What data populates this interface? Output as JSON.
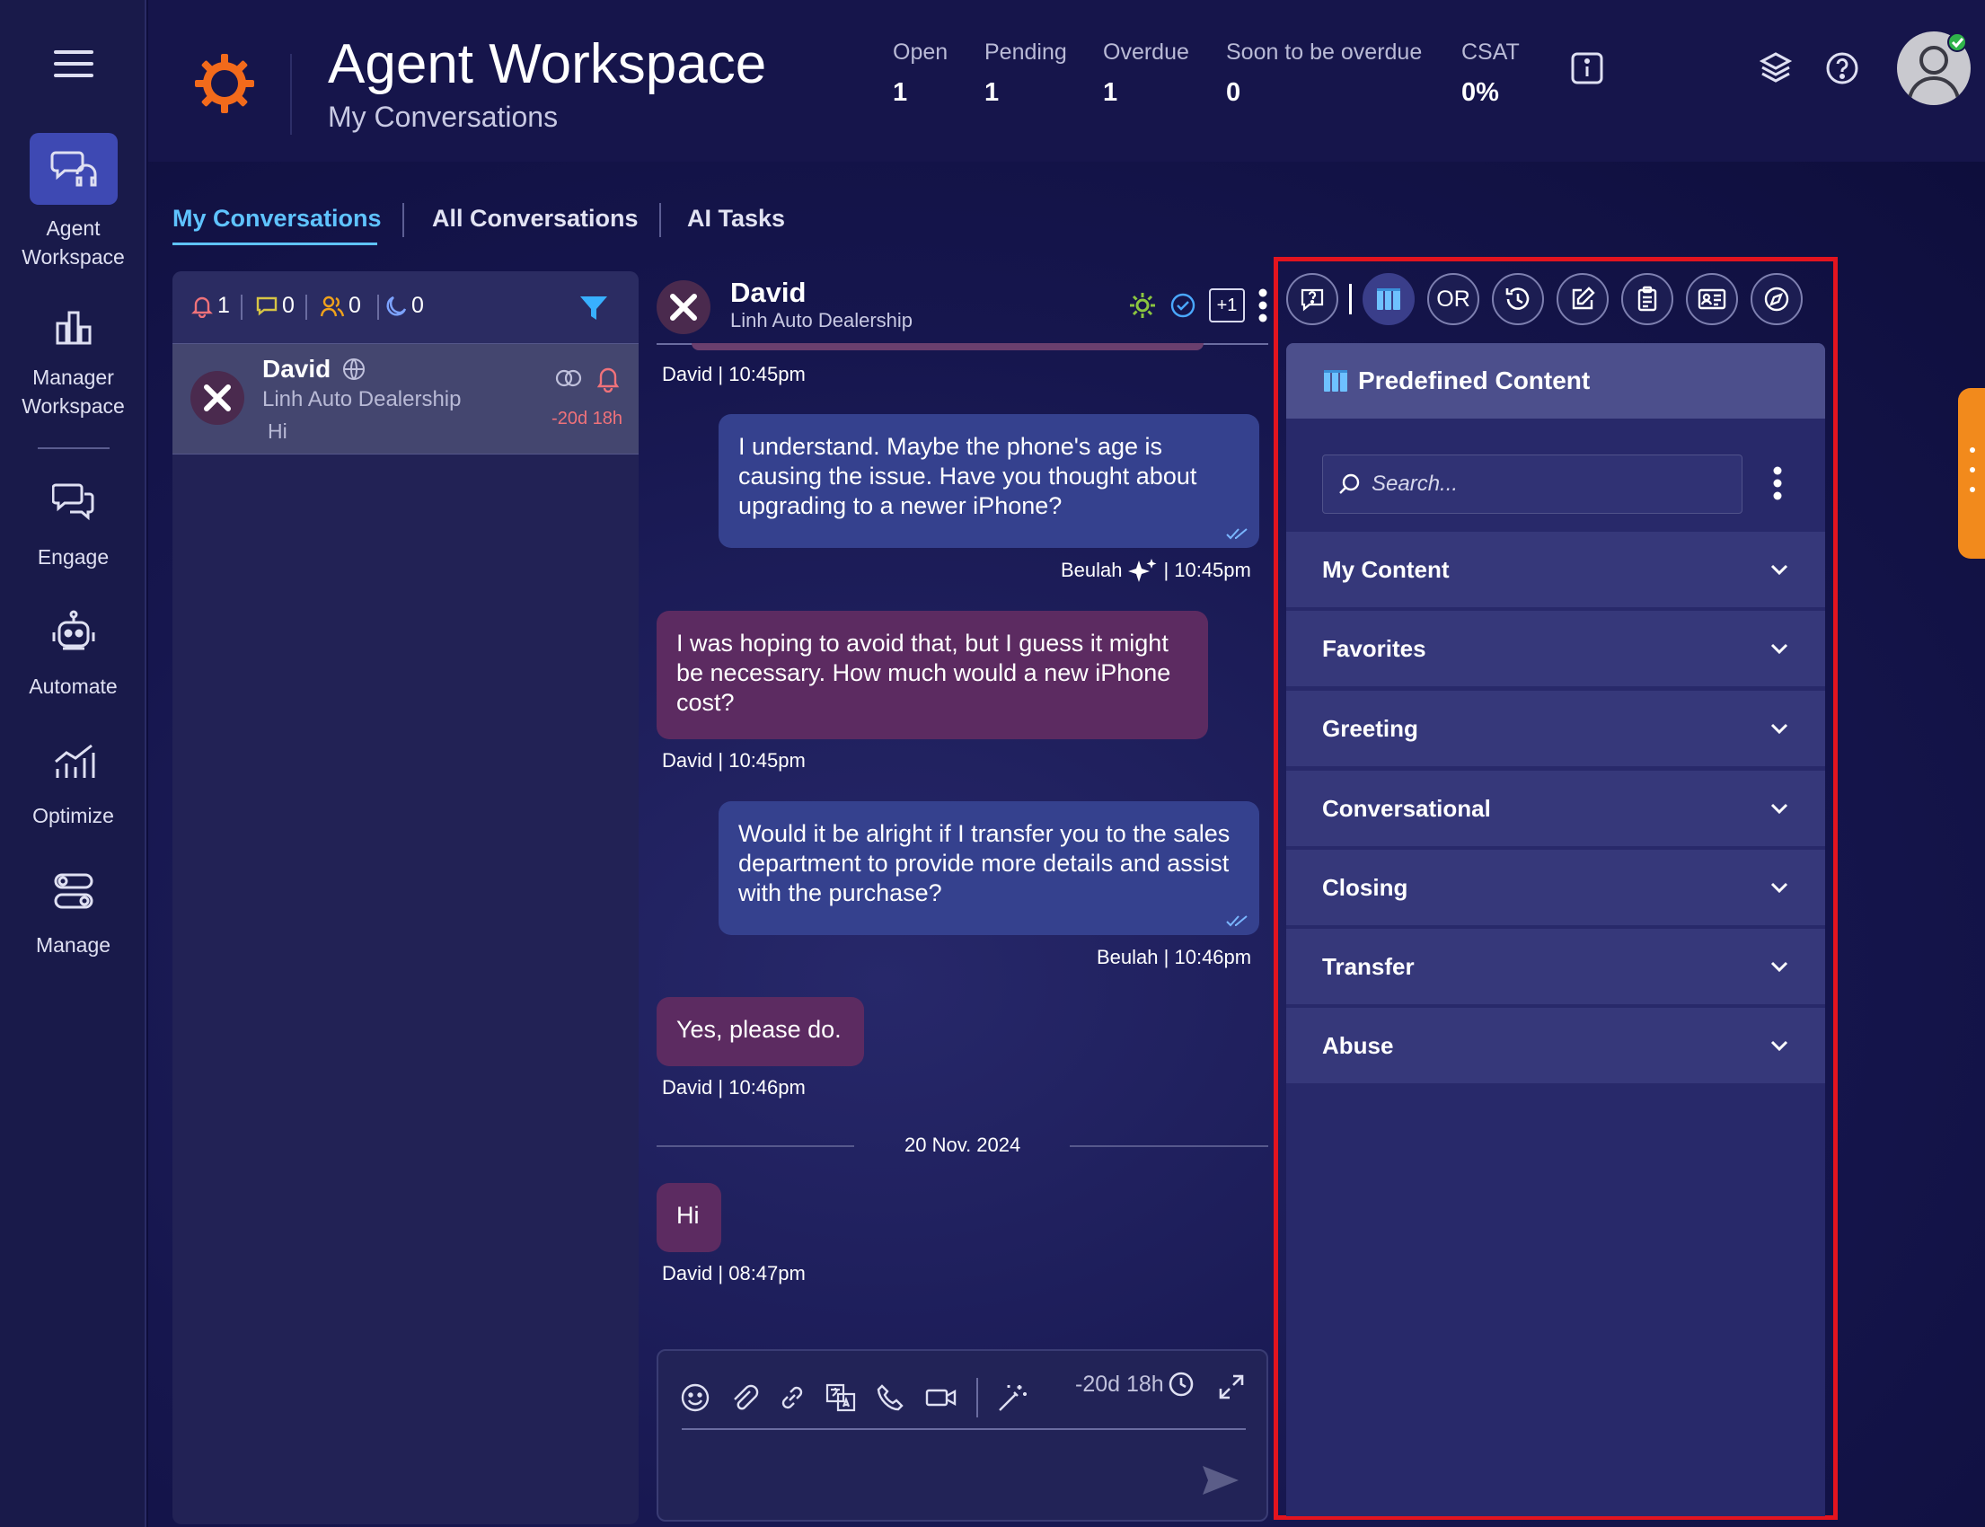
{
  "nav": {
    "items": [
      {
        "label_1": "Agent",
        "label_2": "Workspace"
      },
      {
        "label_1": "Manager",
        "label_2": "Workspace"
      },
      {
        "label_1": "Engage"
      },
      {
        "label_1": "Automate"
      },
      {
        "label_1": "Optimize"
      },
      {
        "label_1": "Manage"
      }
    ]
  },
  "header": {
    "title": "Agent Workspace",
    "subtitle": "My Conversations",
    "stats": [
      {
        "label": "Open",
        "value": "1"
      },
      {
        "label": "Pending",
        "value": "1"
      },
      {
        "label": "Overdue",
        "value": "1"
      },
      {
        "label": "Soon to be overdue",
        "value": "0"
      },
      {
        "label": "CSAT",
        "value": "0%"
      }
    ]
  },
  "tabs": [
    "My Conversations",
    "All Conversations",
    "AI Tasks"
  ],
  "conv_filters": {
    "alerts": "1",
    "messages": "0",
    "users": "0",
    "snoozed": "0"
  },
  "conversation": {
    "name": "David",
    "company": "Linh Auto Dealership",
    "last_message": "Hi",
    "timer": "-20d 18h"
  },
  "chat": {
    "name": "David",
    "company": "Linh Auto Dealership",
    "plus_badge": "+1",
    "messages": [
      {
        "meta_name": "David",
        "meta_time": "10:45pm"
      },
      {
        "text": "I understand. Maybe the phone's age is causing the issue. Have you thought about upgrading to a newer iPhone?",
        "meta_name": "Beulah",
        "meta_time": "10:45pm"
      },
      {
        "text": "I was hoping to avoid that, but I guess it might be necessary. How much would a new iPhone cost?",
        "meta_name": "David",
        "meta_time": "10:45pm"
      },
      {
        "text": "Would it be alright if I transfer you to the sales department to provide more details and assist with the purchase?",
        "meta_name": "Beulah",
        "meta_time": "10:46pm"
      },
      {
        "text": "Yes, please do.",
        "meta_name": "David",
        "meta_time": "10:46pm"
      },
      {
        "text": "Hi",
        "meta_name": "David",
        "meta_time": "08:47pm"
      }
    ],
    "date_separator": "20 Nov. 2024",
    "meta_sep": "|",
    "composer_timer": "-20d 18h"
  },
  "panel": {
    "toolbar_or": "OR",
    "title": "Predefined Content",
    "search_placeholder": "Search...",
    "categories": [
      "My Content",
      "Favorites",
      "Greeting",
      "Conversational",
      "Closing",
      "Transfer",
      "Abuse"
    ]
  }
}
